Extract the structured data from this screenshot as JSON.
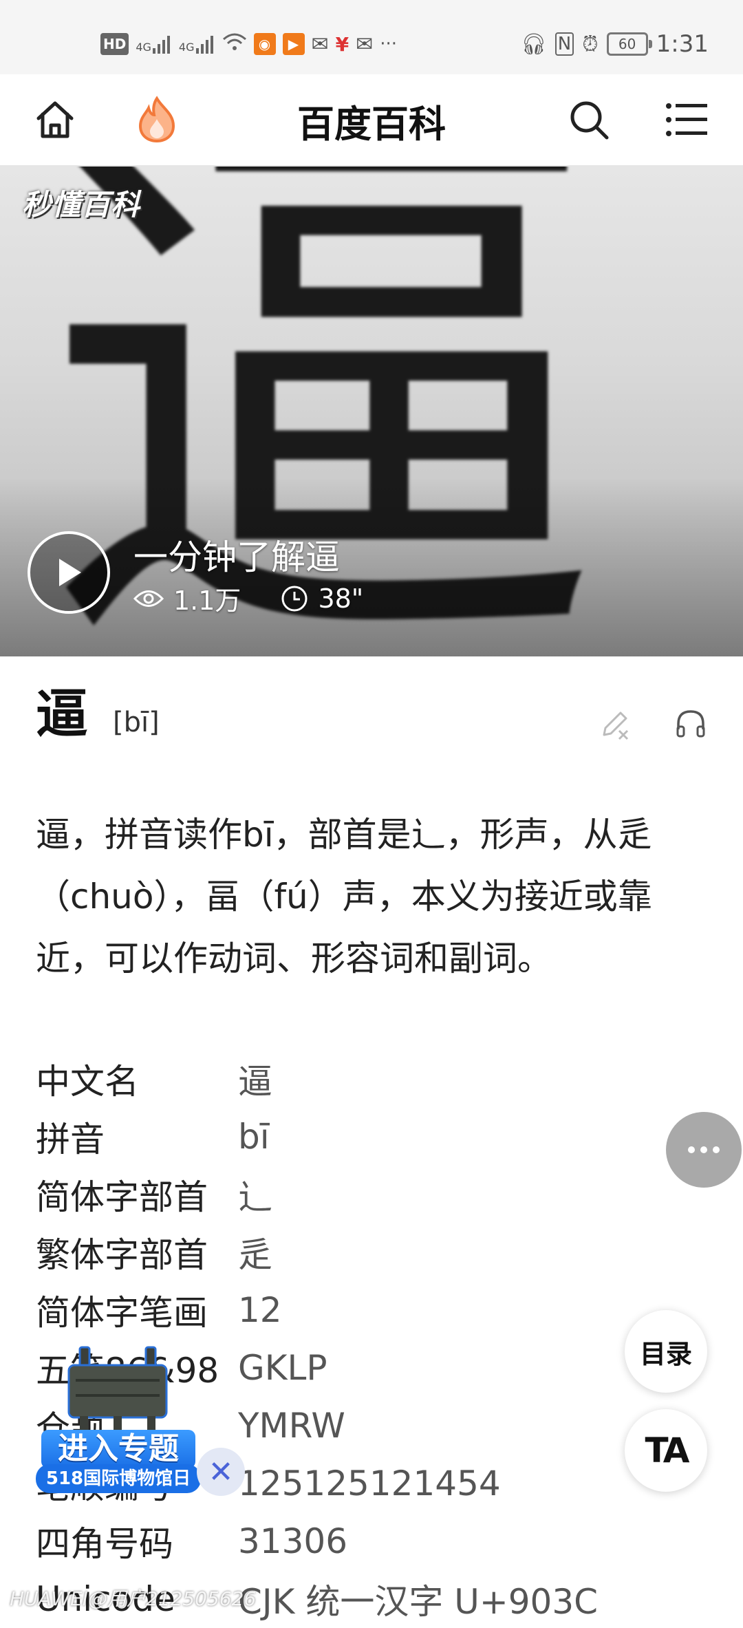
{
  "status_bar": {
    "left_icons": [
      "hd-icon",
      "signal-4g-icon",
      "signal-4g-icon",
      "wifi-icon",
      "app-orange-icon",
      "app-video-icon",
      "mail-icon",
      "yuan-icon",
      "mail-icon",
      "more-dots-icon"
    ],
    "hd_label": "HD",
    "net1": "4G",
    "net2": "4G",
    "overflow": "···",
    "battery": "60",
    "time": "1:31"
  },
  "nav": {
    "title": "百度百科"
  },
  "video": {
    "logo": "秒懂百科",
    "title": "一分钟了解逼",
    "views": "1.1万",
    "duration": "38\""
  },
  "entry": {
    "character": "逼",
    "pinyin": "[bī]",
    "summary": "逼，拼音读作bī，部首是辶，形声，从辵（chuò），畐（fú）声，本义为接近或靠近，可以作动词、形容词和副词。"
  },
  "info": [
    {
      "key": "中文名",
      "value": "逼"
    },
    {
      "key": "拼音",
      "value": "bī"
    },
    {
      "key": "简体字部首",
      "value": "辶"
    },
    {
      "key": "繁体字部首",
      "value": "辵"
    },
    {
      "key": "简体字笔画",
      "value": "12"
    },
    {
      "key": "五笔86&98",
      "value": "GKLP"
    },
    {
      "key": "仓颉",
      "value": "YMRW"
    },
    {
      "key": "笔顺编号",
      "value": "125125121454"
    },
    {
      "key": "四角号码",
      "value": "31306"
    },
    {
      "key": "Unicode",
      "value": "CJK 统一汉字 U+903C"
    }
  ],
  "floating": {
    "toc_label": "目录",
    "ta_label": "TA"
  },
  "promo": {
    "title": "进入专题",
    "subtitle": "518国际博物馆日"
  },
  "watermark": "HUAWEI@用户212505626"
}
